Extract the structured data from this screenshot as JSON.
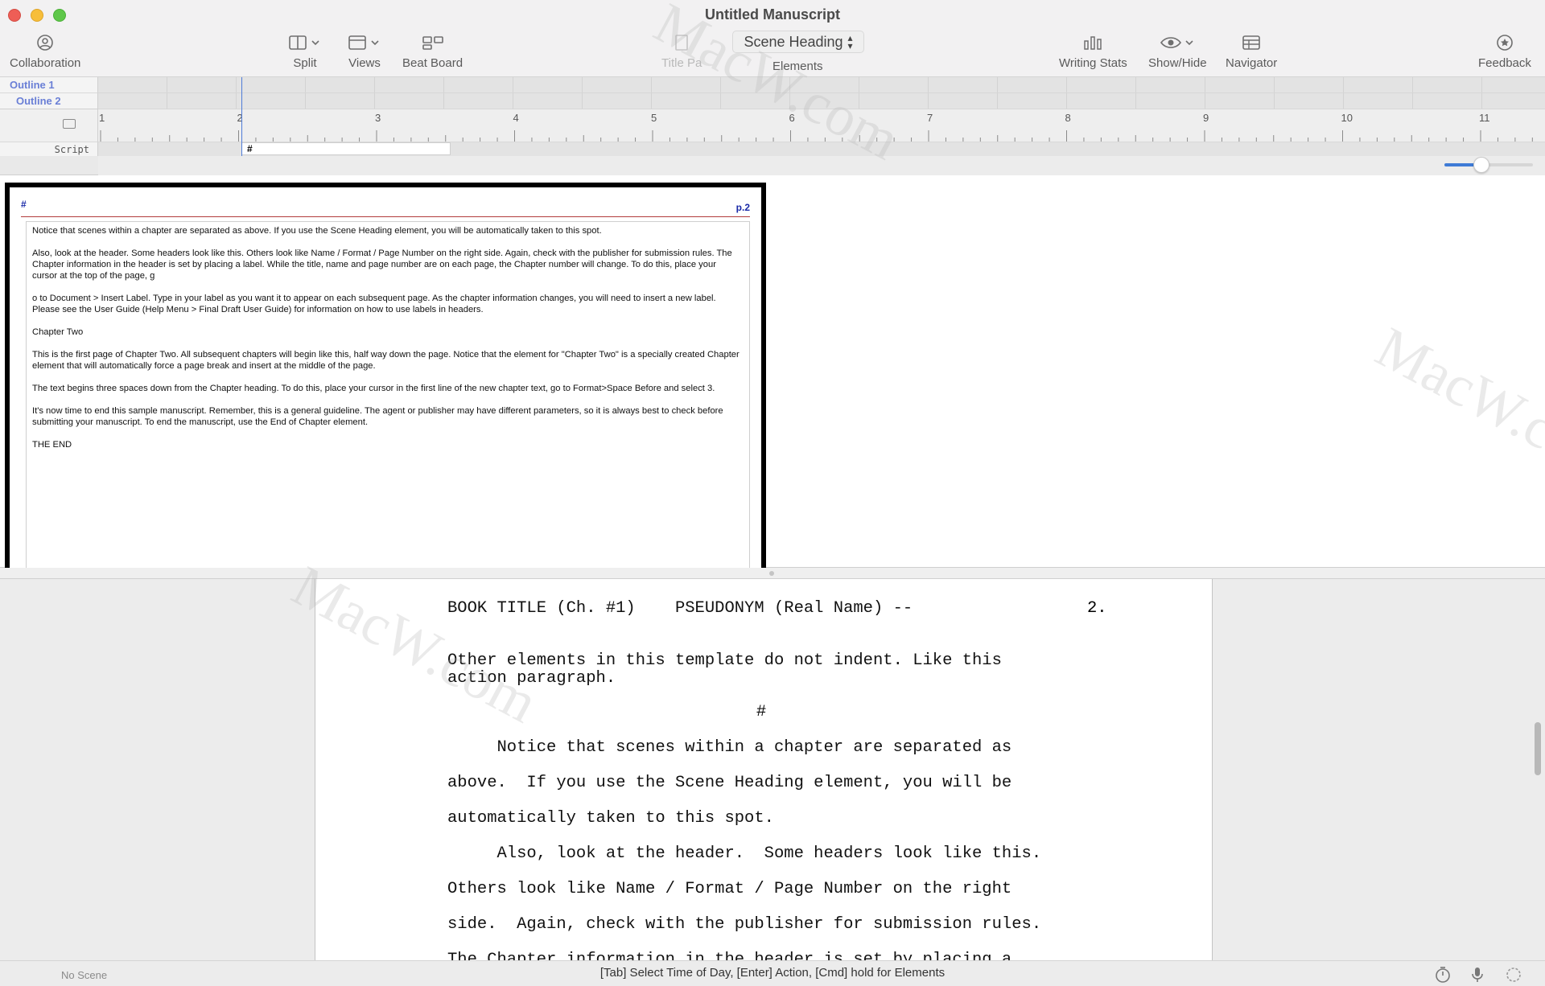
{
  "window": {
    "title": "Untitled Manuscript"
  },
  "toolbar": {
    "collaboration": "Collaboration",
    "split": "Split",
    "views": "Views",
    "beat_board": "Beat Board",
    "title_page": "Title Pa",
    "elements_value": "Scene Heading",
    "elements_label": "Elements",
    "writing_stats": "Writing Stats",
    "show_hide": "Show/Hide",
    "navigator": "Navigator",
    "feedback": "Feedback"
  },
  "outline": {
    "rows": [
      "Outline 1",
      "Outline 2"
    ],
    "script_label": "Script",
    "script_block": "#"
  },
  "ruler": {
    "numbers": [
      "1",
      "2",
      "3",
      "4",
      "5",
      "6",
      "7",
      "8",
      "9",
      "10",
      "11"
    ]
  },
  "zoom": {
    "level": 0.42
  },
  "preview": {
    "header_left": "#",
    "page_number": "p.2",
    "paragraphs": [
      "Notice that scenes within a chapter are separated as above.  If you use the Scene Heading element, you will be automatically taken to this spot.",
      "Also, look at the header.  Some headers look like this.  Others look like Name / Format / Page Number on the right side.  Again, check with the publisher for submission rules.  The Chapter information in the header is set by placing a label.  While the title, name and page number are on each page, the Chapter number will change.  To do this, place your cursor at the top of the page, g",
      "o to Document > Insert Label.  Type in your label as you want it to appear on each subsequent page.  As the chapter information changes, you will need to insert a new label.  Please see the User Guide  (Help Menu > Final Draft User Guide) for information on how to use labels in headers.",
      "Chapter Two",
      "This is the first page of Chapter Two.  All subsequent chapters will begin like this, half way down the page.  Notice that the element for \"Chapter Two\" is a specially created Chapter element that will automatically force a page break and insert at the middle of the page.",
      "The text begins three spaces down from the Chapter heading.  To do this, place your cursor in the first line of the new chapter text, go to Format>Space Before and select 3.",
      "It's now time to end this sample manuscript.  Remember, this is a general guideline.  The agent or publisher may have different parameters, so it is always best to check before submitting your manuscript.  To end the manuscript, use the End of Chapter element.",
      "THE END"
    ]
  },
  "editor": {
    "header": "BOOK TITLE (Ch. #1)    PSEUDONYM (Real Name) --",
    "header_page": "2.",
    "action_line1": "Other elements in this template do not indent. Like this",
    "action_line2": "action paragraph.",
    "scene_sep": "#",
    "lines": [
      "     Notice that scenes within a chapter are separated as",
      "above.  If you use the Scene Heading element, you will be",
      "automatically taken to this spot.",
      "     Also, look at the header.  Some headers look like this.",
      "Others look like Name / Format / Page Number on the right",
      "side.  Again, check with the publisher for submission rules.",
      "The Chapter information in the header is set by placing a"
    ]
  },
  "status": {
    "scene": "No Scene",
    "hint": "[Tab] Select Time of Day, [Enter] Action, [Cmd] hold for Elements"
  },
  "colors": {
    "accent": "#3e7bd6",
    "outline_text": "#6a7fd6",
    "preview_header": "#1a2aa8"
  }
}
